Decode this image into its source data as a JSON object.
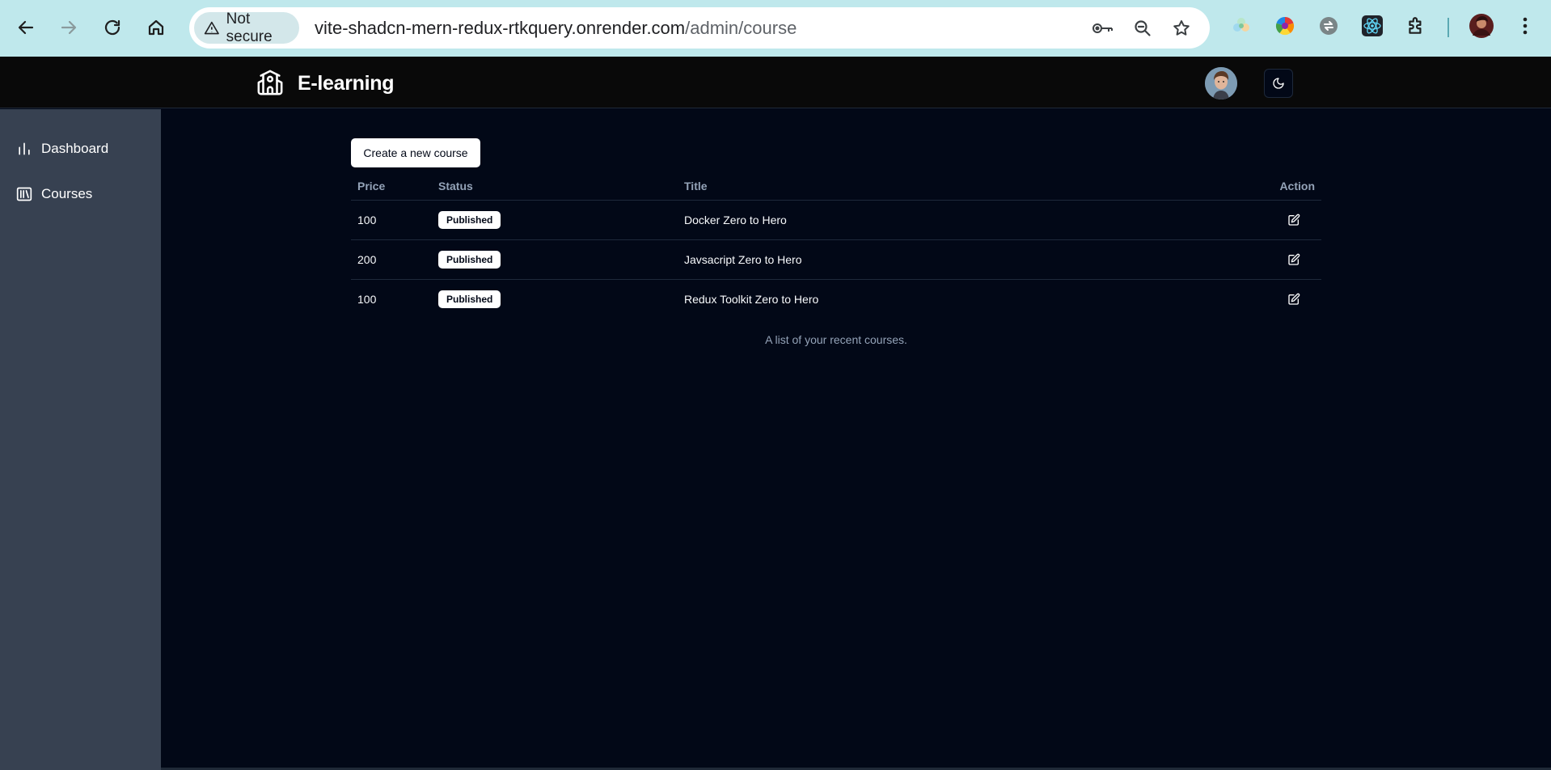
{
  "browser": {
    "security_label": "Not secure",
    "url_host": "vite-shadcn-mern-redux-rtkquery.onrender.com",
    "url_path": "/admin/course"
  },
  "app": {
    "title": "E-learning"
  },
  "sidebar": {
    "items": [
      {
        "label": "Dashboard",
        "icon": "bar-chart-icon"
      },
      {
        "label": "Courses",
        "icon": "library-icon"
      }
    ]
  },
  "main": {
    "create_button_label": "Create a new course",
    "table": {
      "columns": [
        "Price",
        "Status",
        "Title",
        "Action"
      ],
      "rows": [
        {
          "price": "100",
          "status": "Published",
          "title": "Docker Zero to Hero"
        },
        {
          "price": "200",
          "status": "Published",
          "title": "Javsacript Zero to Hero"
        },
        {
          "price": "100",
          "status": "Published",
          "title": "Redux Toolkit Zero to Hero"
        }
      ],
      "caption": "A list of your recent courses."
    }
  },
  "colors": {
    "page_bg": "#020817",
    "header_bg": "#090909",
    "sidebar_bg": "#374151",
    "chrome_bg": "#bfe8ec"
  }
}
